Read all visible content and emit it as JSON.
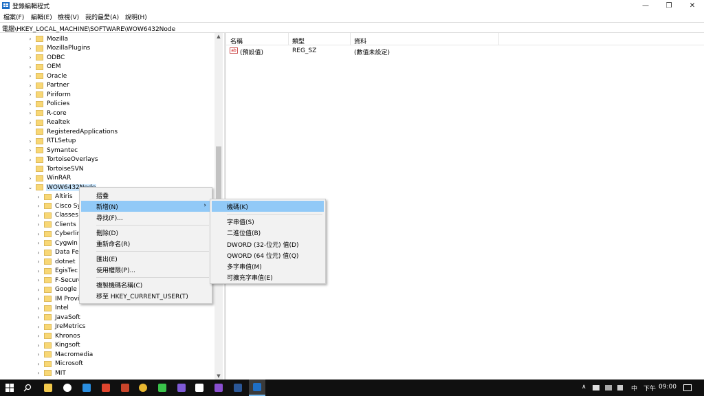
{
  "window": {
    "title": "登錄編輯程式",
    "minimize_glyph": "—",
    "restore_glyph": "❐",
    "close_glyph": "✕"
  },
  "menu": {
    "items": [
      "檔案(F)",
      "編輯(E)",
      "檢視(V)",
      "我的最愛(A)",
      "說明(H)"
    ]
  },
  "address": {
    "path": "電腦\\HKEY_LOCAL_MACHINE\\SOFTWARE\\WOW6432Node"
  },
  "tree": {
    "top_items": [
      {
        "label": "Mozilla",
        "expandable": true
      },
      {
        "label": "MozillaPlugins",
        "expandable": true
      },
      {
        "label": "ODBC",
        "expandable": true
      },
      {
        "label": "OEM",
        "expandable": true
      },
      {
        "label": "Oracle",
        "expandable": true
      },
      {
        "label": "Partner",
        "expandable": true
      },
      {
        "label": "Piriform",
        "expandable": true
      },
      {
        "label": "Policies",
        "expandable": true
      },
      {
        "label": "R-core",
        "expandable": true
      },
      {
        "label": "Realtek",
        "expandable": true
      },
      {
        "label": "RegisteredApplications",
        "expandable": false
      },
      {
        "label": "RTLSetup",
        "expandable": true
      },
      {
        "label": "Symantec",
        "expandable": true
      },
      {
        "label": "TortoiseOverlays",
        "expandable": true
      },
      {
        "label": "TortoiseSVN",
        "expandable": false
      },
      {
        "label": "WinRAR",
        "expandable": true
      }
    ],
    "selected": "WOW6432Node",
    "children": [
      "Altiris",
      "Cisco Sy",
      "Classes",
      "Clients",
      "Cyberlin",
      "Cygwin",
      "Data Fel",
      "dotnet",
      "EgisTec",
      "F-Secure",
      "Google",
      "IM Provi",
      "Intel",
      "JavaSoft",
      "JreMetrics",
      "Khronos",
      "Kingsoft",
      "Macromedia",
      "Microsoft",
      "MIT"
    ]
  },
  "list": {
    "headers": {
      "name": "名稱",
      "type": "類型",
      "data": "資料"
    },
    "rows": [
      {
        "icon": "ab",
        "name": "(預設值)",
        "type": "REG_SZ",
        "data": "(數值未設定)"
      }
    ]
  },
  "context_menu": {
    "collapse": "摺疊",
    "new": "新增(N)",
    "find": "尋找(F)...",
    "delete": "刪除(D)",
    "rename": "重新命名(R)",
    "export": "匯出(E)",
    "permissions": "使用權限(P)...",
    "copy_key_name": "複製機碼名稱(C)",
    "goto_hkcu": "移至 HKEY_CURRENT_USER(T)",
    "arrow": "›"
  },
  "submenu": {
    "key": "機碼(K)",
    "string": "字串值(S)",
    "binary": "二進位值(B)",
    "dword": "DWORD (32-位元) 值(D)",
    "qword": "QWORD (64 位元) 值(Q)",
    "multi_string": "多字串值(M)",
    "expandable_string": "可擴充字串值(E)"
  },
  "taskbar": {
    "tray_ime": "中",
    "tray_ampm": "下午",
    "tray_time": "09:00",
    "tray_up_glyph": "∧"
  },
  "colors": {
    "highlight": "#91c9f7",
    "selection": "#cce8ff",
    "folder": "#f8d775",
    "taskbar": "#101010"
  }
}
